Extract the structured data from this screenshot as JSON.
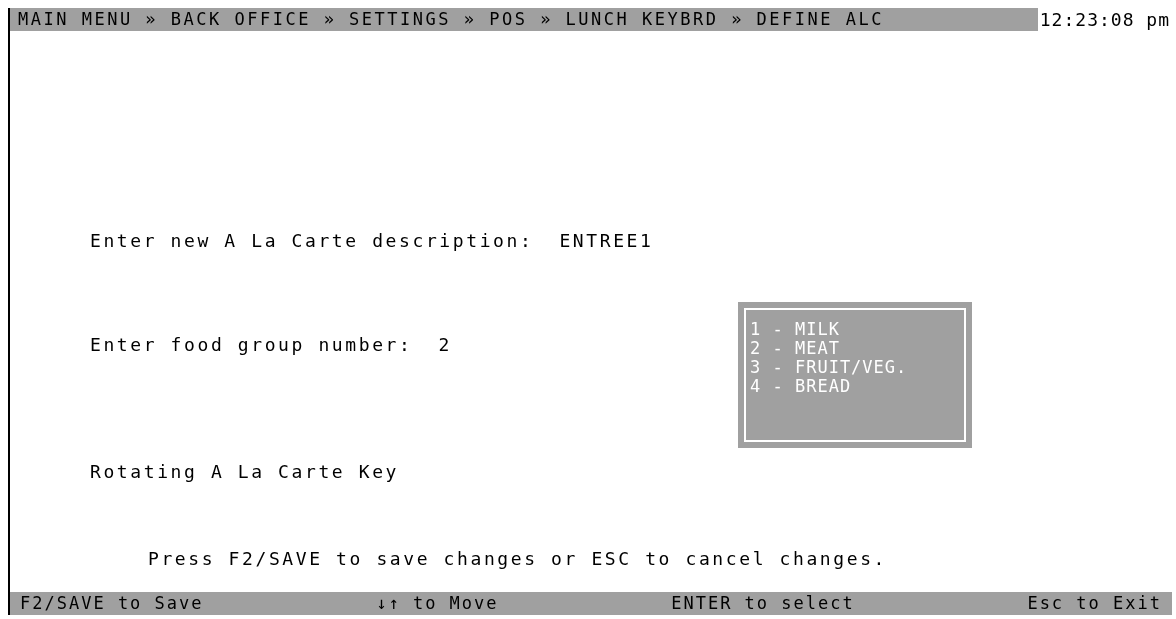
{
  "header": {
    "breadcrumb": "MAIN MENU » BACK OFFICE » SETTINGS » POS » LUNCH KEYBRD » DEFINE ALC",
    "time": "12:23:08 pm"
  },
  "fields": [
    {
      "label": "Enter new A La Carte description:",
      "value": "ENTREE1"
    },
    {
      "label": "Enter food group number:",
      "value": "2"
    }
  ],
  "food_groups": [
    "1 - MILK",
    "2 - MEAT",
    "3 - FRUIT/VEG.",
    "4 - BREAD"
  ],
  "option": "Rotating A La Carte Key",
  "prompt": "Press F2/SAVE to save changes or ESC to cancel changes.",
  "status_bar": [
    "F2/SAVE to Save",
    "↓↑ to Move",
    "ENTER to select",
    "Esc to Exit"
  ]
}
